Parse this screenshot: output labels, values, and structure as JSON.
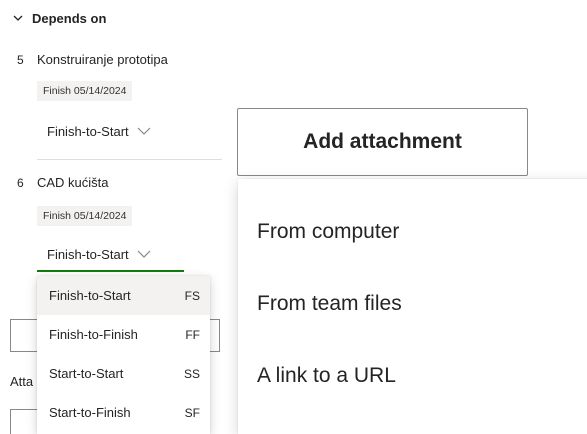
{
  "depends_on": {
    "header": "Depends on",
    "items": [
      {
        "number": "5",
        "name": "Konstruiranje prototipa",
        "finish": "Finish 05/14/2024",
        "type": "Finish-to-Start"
      },
      {
        "number": "6",
        "name": "CAD kućišta",
        "finish": "Finish 05/14/2024",
        "type": "Finish-to-Start"
      }
    ]
  },
  "dependency_type_options": [
    {
      "label": "Finish-to-Start",
      "abbr": "FS",
      "selected": true
    },
    {
      "label": "Finish-to-Finish",
      "abbr": "FF",
      "selected": false
    },
    {
      "label": "Start-to-Start",
      "abbr": "SS",
      "selected": false
    },
    {
      "label": "Start-to-Finish",
      "abbr": "SF",
      "selected": false
    }
  ],
  "attachments": {
    "partial_label": "Atta",
    "add_button_label": "Add attachment",
    "menu_items": [
      "From computer",
      "From team files",
      "A link to a URL"
    ]
  },
  "colors": {
    "accent_underline": "#107c10",
    "selected_bg": "#f3f2f1",
    "badge_bg": "#f3f2f1",
    "divider": "#e1dfdd",
    "border": "#8a8886"
  },
  "icons": {
    "section_toggle": "chevron-down-icon",
    "type_dropdown": "chevron-down-icon"
  }
}
